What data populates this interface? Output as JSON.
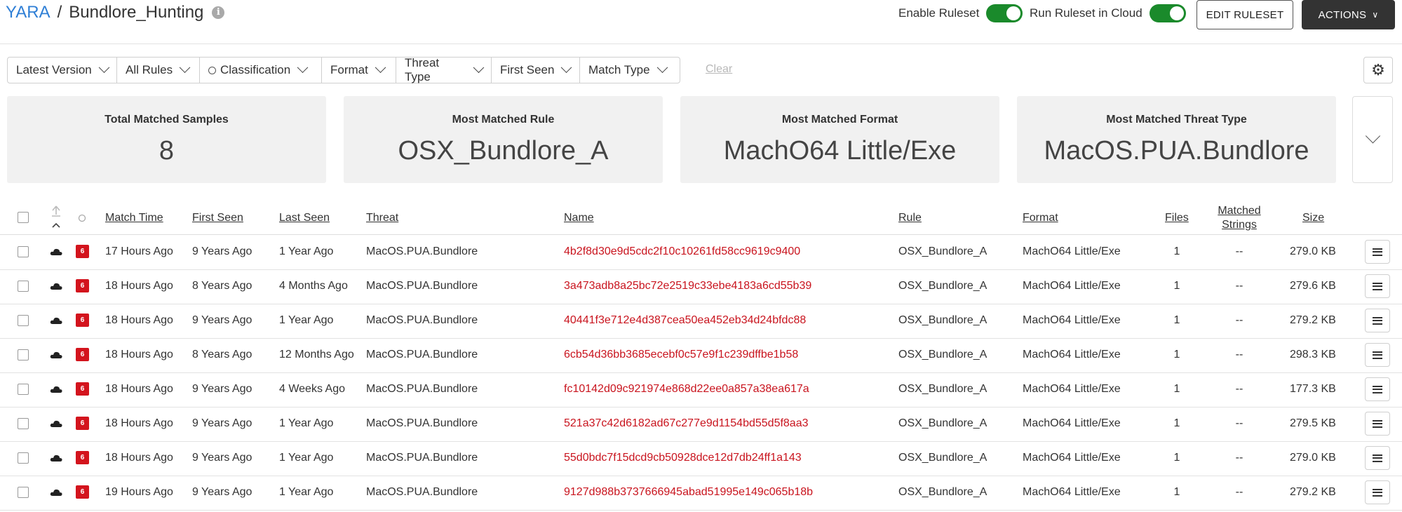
{
  "breadcrumb": {
    "root": "YARA",
    "separator": "/",
    "title": "Bundlore_Hunting",
    "info_glyph": "i"
  },
  "header": {
    "enable_ruleset_label": "Enable Ruleset",
    "run_cloud_label": "Run Ruleset in Cloud",
    "edit_ruleset_label": "EDIT RULESET",
    "actions_label": "ACTIONS",
    "actions_chevron": "∨"
  },
  "filters": {
    "items": [
      {
        "label": "Latest Version"
      },
      {
        "label": "All Rules"
      },
      {
        "label": "Classification"
      },
      {
        "label": "Format"
      },
      {
        "label": "Threat Type"
      },
      {
        "label": "First Seen"
      },
      {
        "label": "Match Type"
      }
    ],
    "clear_label": "Clear",
    "settings_glyph": "⚙"
  },
  "stats": [
    {
      "label": "Total Matched Samples",
      "value": "8"
    },
    {
      "label": "Most Matched Rule",
      "value": "OSX_Bundlore_A"
    },
    {
      "label": "Most Matched Format",
      "value": "MachO64 Little/Exe"
    },
    {
      "label": "Most Matched Threat Type",
      "value": "MacOS.PUA.Bundlore"
    }
  ],
  "table": {
    "columns": {
      "match_time": "Match Time",
      "first_seen": "First Seen",
      "last_seen": "Last Seen",
      "threat": "Threat",
      "name": "Name",
      "rule": "Rule",
      "format": "Format",
      "files": "Files",
      "matched_strings_1": "Matched",
      "matched_strings_2": "Strings",
      "size": "Size"
    },
    "badge_text": "6",
    "rows": [
      {
        "match_time": "17 Hours Ago",
        "first_seen": "9 Years Ago",
        "last_seen": "1 Year Ago",
        "threat": "MacOS.PUA.Bundlore",
        "name": "4b2f8d30e9d5cdc2f10c10261fd58cc9619c9400",
        "rule": "OSX_Bundlore_A",
        "format": "MachO64 Little/Exe",
        "files": "1",
        "matched": "--",
        "size": "279.0 KB"
      },
      {
        "match_time": "18 Hours Ago",
        "first_seen": "8 Years Ago",
        "last_seen": "4 Months Ago",
        "threat": "MacOS.PUA.Bundlore",
        "name": "3a473adb8a25bc72e2519c33ebe4183a6cd55b39",
        "rule": "OSX_Bundlore_A",
        "format": "MachO64 Little/Exe",
        "files": "1",
        "matched": "--",
        "size": "279.6 KB"
      },
      {
        "match_time": "18 Hours Ago",
        "first_seen": "9 Years Ago",
        "last_seen": "1 Year Ago",
        "threat": "MacOS.PUA.Bundlore",
        "name": "40441f3e712e4d387cea50ea452eb34d24bfdc88",
        "rule": "OSX_Bundlore_A",
        "format": "MachO64 Little/Exe",
        "files": "1",
        "matched": "--",
        "size": "279.2 KB"
      },
      {
        "match_time": "18 Hours Ago",
        "first_seen": "8 Years Ago",
        "last_seen": "12 Months Ago",
        "threat": "MacOS.PUA.Bundlore",
        "name": "6cb54d36bb3685ecebf0c57e9f1c239dffbe1b58",
        "rule": "OSX_Bundlore_A",
        "format": "MachO64 Little/Exe",
        "files": "1",
        "matched": "--",
        "size": "298.3 KB"
      },
      {
        "match_time": "18 Hours Ago",
        "first_seen": "9 Years Ago",
        "last_seen": "4 Weeks Ago",
        "threat": "MacOS.PUA.Bundlore",
        "name": "fc10142d09c921974e868d22ee0a857a38ea617a",
        "rule": "OSX_Bundlore_A",
        "format": "MachO64 Little/Exe",
        "files": "1",
        "matched": "--",
        "size": "177.3 KB"
      },
      {
        "match_time": "18 Hours Ago",
        "first_seen": "9 Years Ago",
        "last_seen": "1 Year Ago",
        "threat": "MacOS.PUA.Bundlore",
        "name": "521a37c42d6182ad67c277e9d1154bd55d5f8aa3",
        "rule": "OSX_Bundlore_A",
        "format": "MachO64 Little/Exe",
        "files": "1",
        "matched": "--",
        "size": "279.5 KB"
      },
      {
        "match_time": "18 Hours Ago",
        "first_seen": "9 Years Ago",
        "last_seen": "1 Year Ago",
        "threat": "MacOS.PUA.Bundlore",
        "name": "55d0bdc7f15dcd9cb50928dce12d7db24ff1a143",
        "rule": "OSX_Bundlore_A",
        "format": "MachO64 Little/Exe",
        "files": "1",
        "matched": "--",
        "size": "279.0 KB"
      },
      {
        "match_time": "19 Hours Ago",
        "first_seen": "9 Years Ago",
        "last_seen": "1 Year Ago",
        "threat": "MacOS.PUA.Bundlore",
        "name": "9127d988b3737666945abad51995e149c065b18b",
        "rule": "OSX_Bundlore_A",
        "format": "MachO64 Little/Exe",
        "files": "1",
        "matched": "--",
        "size": "279.2 KB"
      }
    ]
  },
  "colors": {
    "brand_blue": "#2f7fd6",
    "toggle_green": "#1a8a2b",
    "hash_red": "#c9141e",
    "badge_red": "#d3141d"
  }
}
